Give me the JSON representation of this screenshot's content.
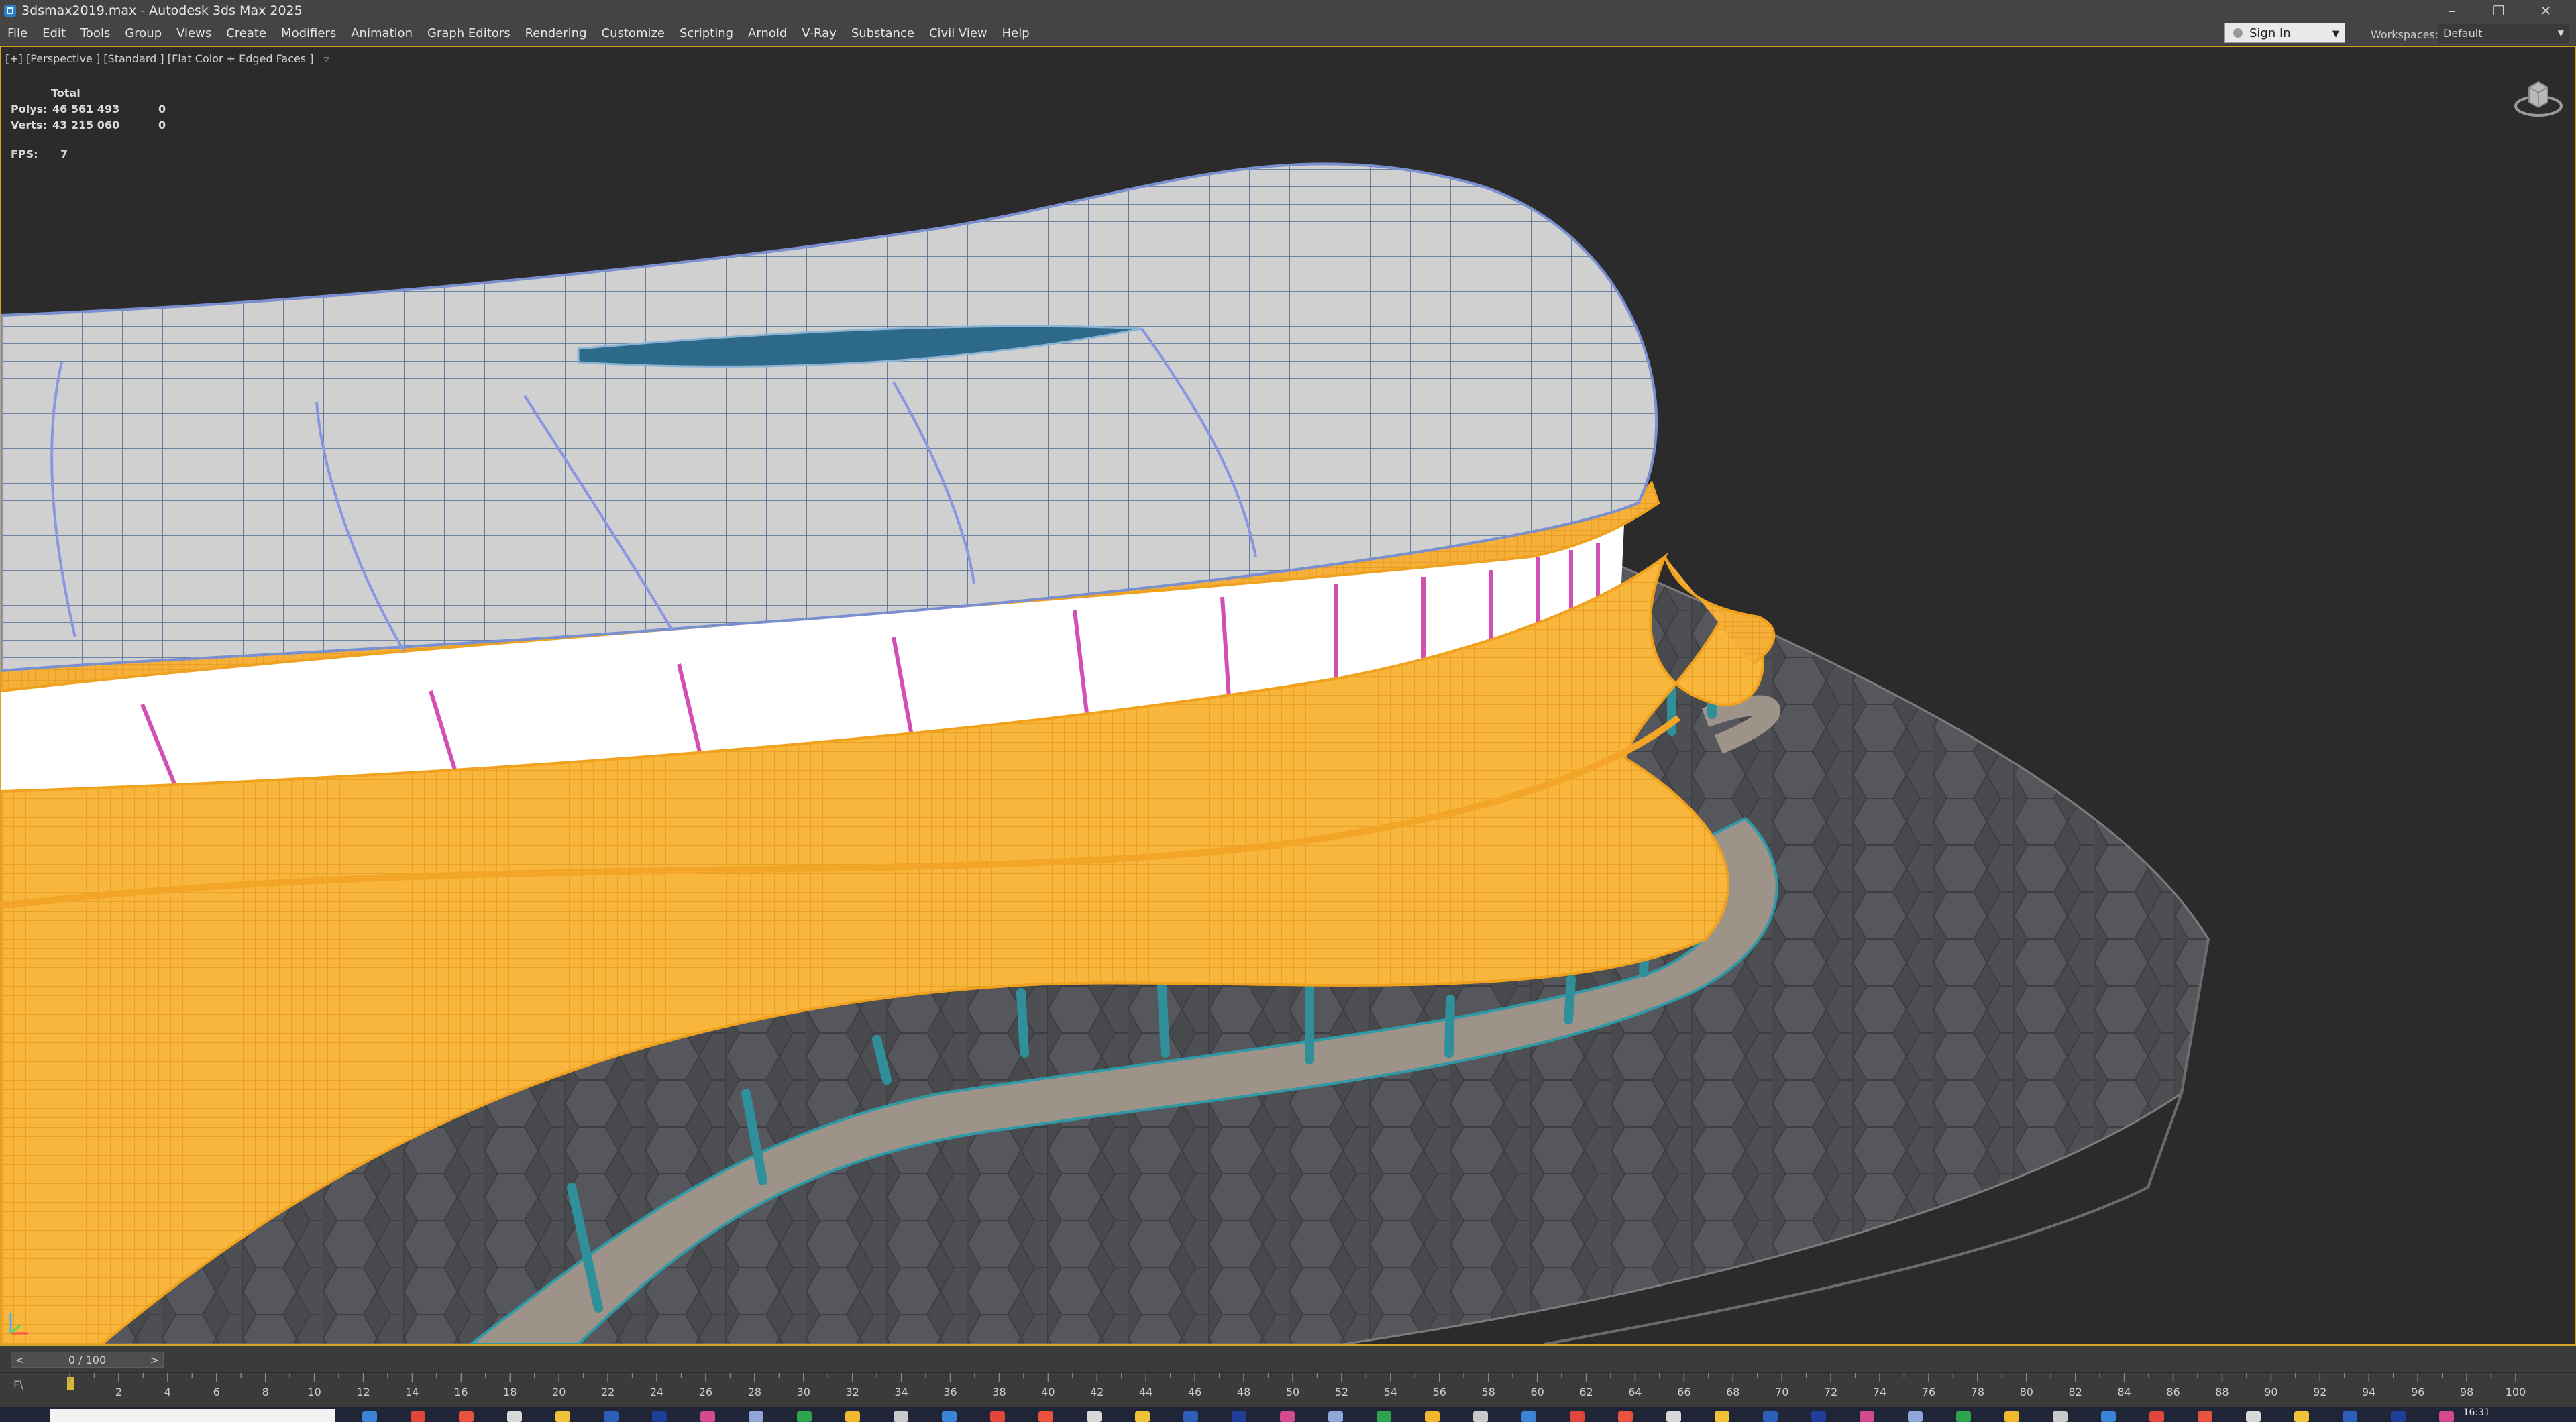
{
  "window": {
    "title": "3dsmax2019.max - Autodesk 3ds Max 2025",
    "app_icon": "3ds-max-icon",
    "controls": [
      "minimize-icon",
      "restore-icon",
      "close-icon"
    ]
  },
  "menu": {
    "items": [
      "File",
      "Edit",
      "Tools",
      "Group",
      "Views",
      "Create",
      "Modifiers",
      "Animation",
      "Graph Editors",
      "Rendering",
      "Customize",
      "Scripting",
      "Arnold",
      "V-Ray",
      "Substance",
      "Civil View",
      "Help"
    ],
    "sign_in": "Sign In",
    "workspaces_label": "Workspaces:",
    "workspace_value": "Default"
  },
  "viewport": {
    "label": "[+] [Perspective ] [Standard ] [Flat Color + Edged Faces ]",
    "stats": {
      "header": "Total",
      "polys_label": "Polys:",
      "polys_value": "46 561 493",
      "polys_selected": "0",
      "verts_label": "Verts:",
      "verts_value": "43 215 060",
      "verts_selected": "0"
    },
    "fps_label": "FPS:",
    "fps_value": "7",
    "colors": {
      "background": "#2b2b2b",
      "active_border": "#d7a326",
      "roof_fill": "#cfcfcf",
      "roof_wire": "#3b5e86",
      "canopy": "#f7b034",
      "columns": "#2f8f9a",
      "mullions": "#d050b0",
      "ground": "#4a4c50",
      "path": "#9d9388"
    }
  },
  "timeline": {
    "frame_display": "0 / 100",
    "prev_label": "<",
    "next_label": ">",
    "curve_label": "F\\",
    "ticks": [
      "2",
      "4",
      "6",
      "8",
      "10",
      "12",
      "14",
      "16",
      "18",
      "20",
      "22",
      "24",
      "26",
      "28",
      "30",
      "32",
      "34",
      "36",
      "38",
      "40",
      "42",
      "44",
      "46",
      "48",
      "50",
      "52",
      "54",
      "56",
      "58",
      "60",
      "62",
      "64",
      "66",
      "68",
      "70",
      "72",
      "74",
      "76",
      "78",
      "80",
      "82",
      "84",
      "86",
      "88",
      "90",
      "92",
      "94",
      "96",
      "98",
      "100"
    ]
  },
  "taskbar": {
    "time": "16:31"
  }
}
